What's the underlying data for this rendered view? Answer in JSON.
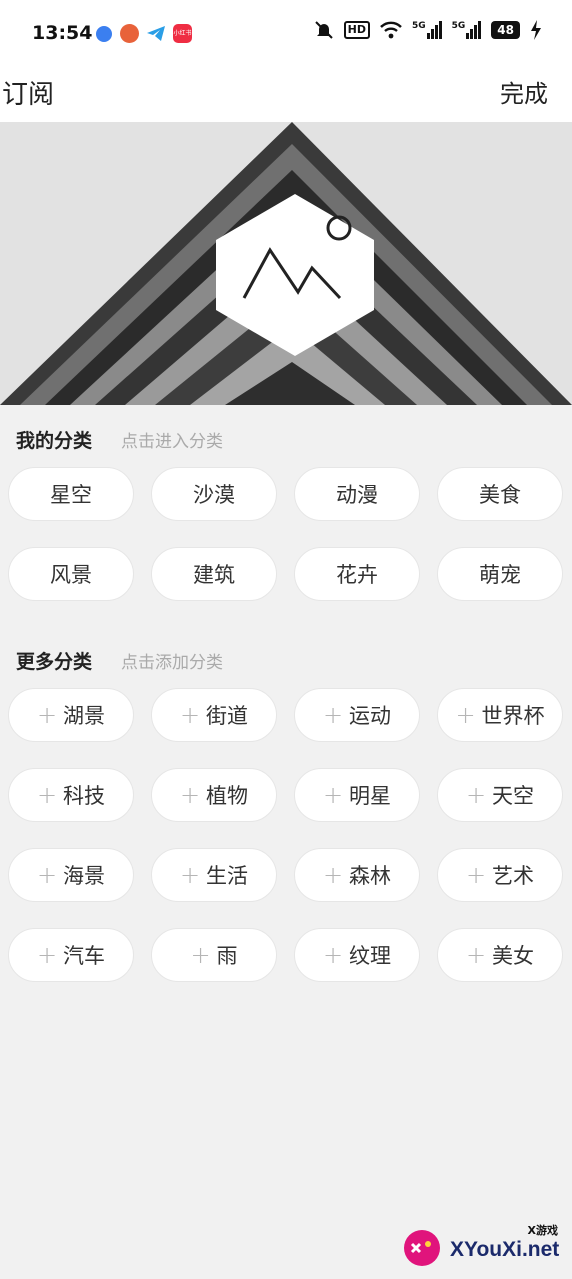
{
  "status_bar": {
    "time": "13:54",
    "notification_icons": [
      "browser-icon",
      "food-app-icon",
      "telegram-icon",
      "red-app-icon"
    ],
    "red_app_label": "小红书",
    "hd_label": "HD",
    "signal1_label": "5G",
    "signal2_label": "5G",
    "battery": "48"
  },
  "header": {
    "title": "订阅",
    "done_label": "完成"
  },
  "my_categories": {
    "title": "我的分类",
    "hint": "点击进入分类",
    "items": [
      "星空",
      "沙漠",
      "动漫",
      "美食",
      "风景",
      "建筑",
      "花卉",
      "萌宠"
    ]
  },
  "more_categories": {
    "title": "更多分类",
    "hint": "点击添加分类",
    "plus_symbol": "+",
    "items": [
      "湖景",
      "街道",
      "运动",
      "世界杯",
      "科技",
      "植物",
      "明星",
      "天空",
      "海景",
      "生活",
      "森林",
      "艺术",
      "汽车",
      "雨",
      "纹理",
      "美女"
    ]
  },
  "watermark": {
    "text": "XYouXi.net",
    "small_text": "X游戏"
  },
  "colors": {
    "background": "#f1f1f1",
    "chip_bg": "#ffffff",
    "hint": "#aaaaaa",
    "watermark_accent": "#e0147c"
  }
}
